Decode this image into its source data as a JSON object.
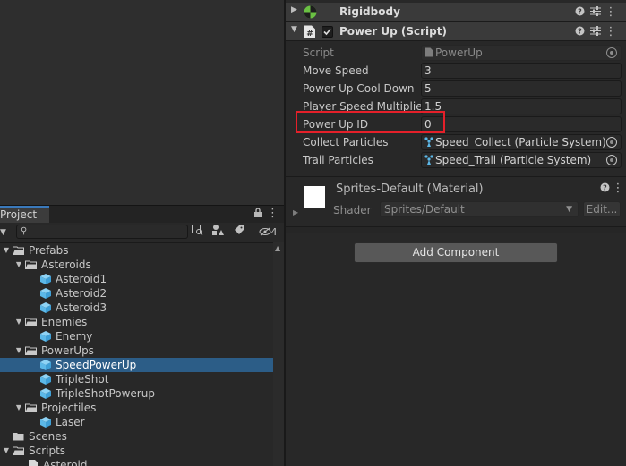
{
  "project": {
    "tab_label": "Project",
    "search_placeholder": "",
    "hidden_count": "4",
    "tree": [
      {
        "label": "Prefabs",
        "kind": "folder",
        "depth": 0,
        "expanded": true
      },
      {
        "label": "Asteroids",
        "kind": "folder",
        "depth": 1,
        "expanded": true
      },
      {
        "label": "Asteroid1",
        "kind": "prefab",
        "depth": 2
      },
      {
        "label": "Asteroid2",
        "kind": "prefab",
        "depth": 2
      },
      {
        "label": "Asteroid3",
        "kind": "prefab",
        "depth": 2
      },
      {
        "label": "Enemies",
        "kind": "folder",
        "depth": 1,
        "expanded": true
      },
      {
        "label": "Enemy",
        "kind": "prefab",
        "depth": 2
      },
      {
        "label": "PowerUps",
        "kind": "folder",
        "depth": 1,
        "expanded": true
      },
      {
        "label": "SpeedPowerUp",
        "kind": "prefab",
        "depth": 2,
        "selected": true
      },
      {
        "label": "TripleShot",
        "kind": "prefab",
        "depth": 2
      },
      {
        "label": "TripleShotPowerup",
        "kind": "prefab",
        "depth": 2
      },
      {
        "label": "Projectiles",
        "kind": "folder",
        "depth": 1,
        "expanded": true
      },
      {
        "label": "Laser",
        "kind": "prefab",
        "depth": 2
      },
      {
        "label": "Scenes",
        "kind": "folder",
        "depth": 0,
        "expanded": false
      },
      {
        "label": "Scripts",
        "kind": "folder",
        "depth": 0,
        "expanded": true
      },
      {
        "label": "Asteroid",
        "kind": "script",
        "depth": 1
      }
    ]
  },
  "inspector": {
    "rigidbody_title": "Rigidbody",
    "powerup_title": "Power Up (Script)",
    "properties": {
      "script_label": "Script",
      "script_value": "PowerUp",
      "move_speed_label": "Move Speed",
      "move_speed_value": "3",
      "cooldown_label": "Power Up Cool Down",
      "cooldown_value": "5",
      "multiplier_label": "Player Speed Multiplier",
      "multiplier_value": "1.5",
      "powerup_id_label": "Power Up ID",
      "powerup_id_value": "0",
      "collect_label": "Collect Particles",
      "collect_value": "Speed_Collect (Particle System)",
      "trail_label": "Trail Particles",
      "trail_value": "Speed_Trail (Particle System)"
    },
    "material": {
      "name": "Sprites-Default (Material)",
      "shader_label": "Shader",
      "shader_value": "Sprites/Default",
      "edit_label": "Edit..."
    },
    "add_component_label": "Add Component"
  },
  "colors": {
    "selection": "#2c5d87",
    "highlight": "#e5202a",
    "folder": "#c9c9c9",
    "prefab": "#5cb8e8"
  }
}
